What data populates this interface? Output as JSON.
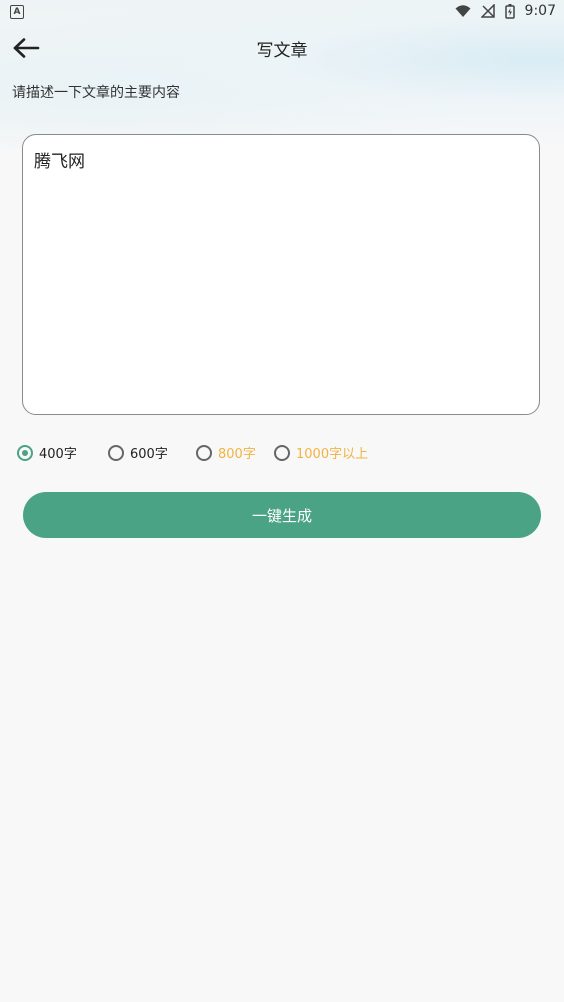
{
  "status_bar": {
    "notification_icon": "a-notification-icon",
    "time": "9:07",
    "icons": [
      "wifi-icon",
      "no-signal-icon",
      "battery-icon"
    ]
  },
  "appbar": {
    "back_icon": "arrow-left-icon",
    "title": "写文章"
  },
  "prompt": {
    "label": "请描述一下文章的主要内容"
  },
  "content_input": {
    "value": "腾飞网"
  },
  "length_options": [
    {
      "label": "400字",
      "selected": true,
      "enabled": true
    },
    {
      "label": "600字",
      "selected": false,
      "enabled": true
    },
    {
      "label": "800字",
      "selected": false,
      "enabled": false
    },
    {
      "label": "1000字以上",
      "selected": false,
      "enabled": false
    }
  ],
  "actions": {
    "generate_label": "一键生成"
  },
  "colors": {
    "accent": "#4aa384",
    "disabled_text": "#f2b341",
    "background": "#f8f8f8"
  }
}
